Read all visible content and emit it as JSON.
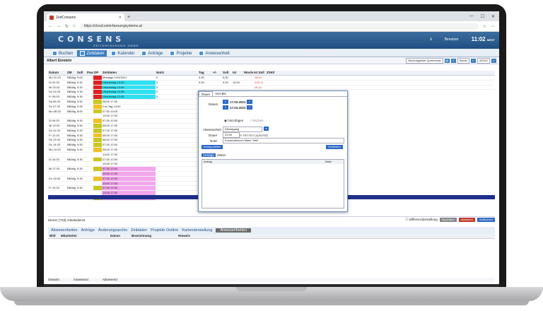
{
  "browser": {
    "tab_title": "ZeitConsens",
    "url": "https://cloud.zeiterfassungsysteme.at"
  },
  "banner": {
    "logo": "CONSENS",
    "logo_sub": "ZEITERFASSUNG GMBH",
    "user": "Benutzer",
    "time": "11:02",
    "tz": "MEST"
  },
  "tabs": [
    "Buchen",
    "Zeitdaten",
    "Kalender",
    "Anträge",
    "Projekte",
    "Anwesenheit"
  ],
  "toolbar": {
    "user_name": "Albert Einstein",
    "list_format": "Buchungsliste Querformat",
    "period": "Monat",
    "date": "3/2021"
  },
  "left_headers": [
    "Datum",
    "ZM",
    "Soll",
    "Pause",
    "DP",
    "Zeitdaten",
    "Notiz"
  ],
  "left_rows": [
    [
      "Mo 01.03",
      "BBAllg",
      "9:00",
      "",
      "",
      "Montage 1/03/2021",
      "0"
    ],
    [
      "Di 02.03",
      "BBAllg",
      "9:30",
      "",
      "",
      "Urlaubstag 13:45",
      "0"
    ],
    [
      "Mi 03.03",
      "BBAllg",
      "9:30",
      "",
      "",
      "Urlaubstag 13:45",
      "0"
    ],
    [
      "Do 04.03",
      "BBAllg",
      "9:30",
      "",
      "",
      "Urlaubstag 13:45",
      "0"
    ],
    [
      "Fr 05.03",
      "BBAllg",
      "9:30",
      "",
      "",
      "Urlaubstag 13:45",
      "0"
    ],
    [
      "Sa 06.03",
      "BBAllg",
      "9:30",
      "",
      "",
      "08:00 17:00",
      ""
    ],
    [
      "So 07.03",
      "BBAllg",
      "9:30",
      "",
      "",
      "Frei Tag 13:00",
      ""
    ],
    [
      "Mo 08.03",
      "BBAllg",
      "8:00",
      "",
      "",
      "07:30 13:00",
      ""
    ],
    [
      "",
      "",
      "",
      "",
      "",
      "13:00 17:00",
      ""
    ],
    [
      "Di 09.03",
      "BBAllg",
      "9:30",
      "",
      "",
      "07:30 12:00",
      ""
    ],
    [
      "Mi 10.03",
      "BBAllg",
      "9:30",
      "",
      "",
      "08:00 17:00",
      ""
    ],
    [
      "Do 11.03",
      "BBAllg",
      "9:30",
      "",
      "",
      "07:30 17:00",
      ""
    ],
    [
      "Fr 12.03",
      "BBAllg",
      "9:30",
      "",
      "",
      "08:00 17:00",
      ""
    ],
    [
      "Sa 13.03",
      "BBAllg",
      "9:30",
      "",
      "",
      "08:00 17:00",
      ""
    ],
    [
      "So 14.03",
      "BBAllg",
      "9:30",
      "",
      "",
      "07:30 12:00",
      ""
    ],
    [
      "Mo 15.03",
      "BBAllg",
      "9:30",
      "",
      "",
      "08:00 17:00",
      ""
    ],
    [
      "",
      "",
      "",
      "",
      "",
      "13:00 17:00",
      ""
    ],
    [
      "Di 16.03",
      "BBAllg",
      "9:30",
      "",
      "",
      "07:30 12:00",
      ""
    ],
    [
      "",
      "",
      "",
      "",
      "",
      "13:00 17:00",
      ""
    ],
    [
      "Mi 17.03",
      "BBAllg",
      "9:30",
      "",
      "",
      "07:30 12:00",
      ""
    ],
    [
      "",
      "",
      "",
      "",
      "",
      "13:00 17:00",
      ""
    ],
    [
      "Do 18.03",
      "BBAllg",
      "9:30",
      "",
      "",
      "07:30 12:00",
      ""
    ],
    [
      "",
      "",
      "",
      "",
      "",
      "13:00 17:00",
      ""
    ],
    [
      "Fr 19.03",
      "BBAllg",
      "9:30",
      "",
      "",
      "07:30 12:00",
      ""
    ],
    [
      "",
      "",
      "",
      "",
      "",
      "13:00 17:00",
      ""
    ],
    [
      "Sa 20.03",
      "BBAllg",
      "9:30",
      "",
      "",
      "07:30 12:00",
      ""
    ]
  ],
  "right_headers": [
    "Tag",
    "+/-",
    "Soll",
    "Ist",
    "Woche",
    "Ist Soll",
    "ZSKF"
  ],
  "right_rows": [
    [
      "9:30",
      "",
      "9:30",
      "",
      "",
      "-93:41",
      ""
    ],
    [
      "9:30",
      "",
      "9:30",
      "10:00",
      "",
      "-103:11",
      ""
    ],
    [
      "",
      "",
      "",
      "",
      "",
      "-91:11",
      ""
    ]
  ],
  "dialog": {
    "tabs": [
      "Dauer",
      "Von-Bis"
    ],
    "datum_label": "Datum",
    "date_from": "17.03.2021",
    "date_to": "17.03.2021",
    "radio_add": "hinzufügen",
    "radio_delete": "löschen",
    "absence_label": "Abwesenheit",
    "absence_value": "Dienstgang",
    "dauer_label": "Dauer",
    "dauer_value": "03:30",
    "dauer_hint": "in HH:mm (optional)",
    "notiz_label": "Notiz",
    "notiz_value": "Kundenbesuch Maier Tetlh",
    "btn_request": "Antrag stellen",
    "btn_close": "Schließen",
    "subtabs": [
      "Anträge",
      "Zeiten"
    ],
    "col_antrag": "Antrag",
    "col_notiz": "Notiz"
  },
  "status": {
    "dienst": "Dienst: [703] Arbeitsdienst",
    "difference": "Differenzdarstellung",
    "btn_send": "Speichern",
    "btn_insert": "einsetzen",
    "btn_refresh": "Aufbuchen"
  },
  "bottom_tabs": [
    "Abwesenheiten",
    "Anträge",
    "Änderungsarchiv",
    "Zeitdaten",
    "Projekte Outline",
    "Kartenderstellung",
    "Anwesenheiten"
  ],
  "bottom_headers": [
    "Bild",
    "Mitarbeiter",
    "Datum",
    "Bezeichnung",
    "Hinweis"
  ],
  "footer": [
    "Gesamt",
    "Anwesend",
    "Abwesend"
  ]
}
